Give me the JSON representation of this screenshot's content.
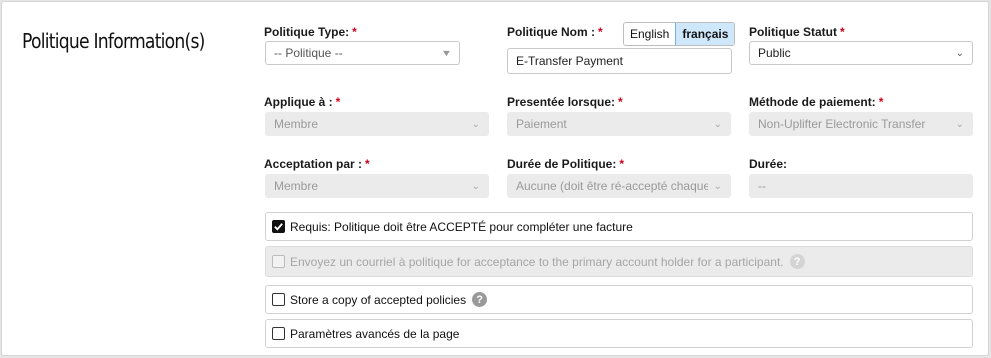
{
  "section": {
    "title": "Politique Information(s)"
  },
  "language": {
    "options": [
      "English",
      "français"
    ],
    "active": "français"
  },
  "fields": {
    "type": {
      "label": "Politique Type:",
      "value": "-- Politique --"
    },
    "nom": {
      "label": "Politique Nom :",
      "value": "E-Transfer Payment"
    },
    "statut": {
      "label": "Politique Statut",
      "value": "Public"
    },
    "applique": {
      "label": "Applique à :",
      "value": "Membre"
    },
    "presentee": {
      "label": "Presentée lorsque:",
      "value": "Paiement"
    },
    "methode": {
      "label": "Méthode de paiement:",
      "value": "Non-Uplifter Electronic Transfer"
    },
    "acceptation": {
      "label": "Acceptation par :",
      "value": "Membre"
    },
    "duree_politique": {
      "label": "Durée de Politique:",
      "value": "Aucune (doit être ré-accepté chaque fois)"
    },
    "duree": {
      "label": "Durée:",
      "value": "--"
    }
  },
  "required_mark": "*",
  "checkboxes": {
    "requis": {
      "label": "Requis: Politique doit être ACCEPTÉ pour compléter une facture",
      "checked": true
    },
    "courriel": {
      "label": "Envoyez un courriel à politique for acceptance to the primary account holder for a participant.",
      "checked": false,
      "disabled": true
    },
    "store": {
      "label": "Store a copy of accepted policies",
      "checked": false
    },
    "avances": {
      "label": "Paramètres avancés de la page",
      "checked": false
    }
  },
  "icons": {
    "help": "?",
    "caret": "▾"
  }
}
